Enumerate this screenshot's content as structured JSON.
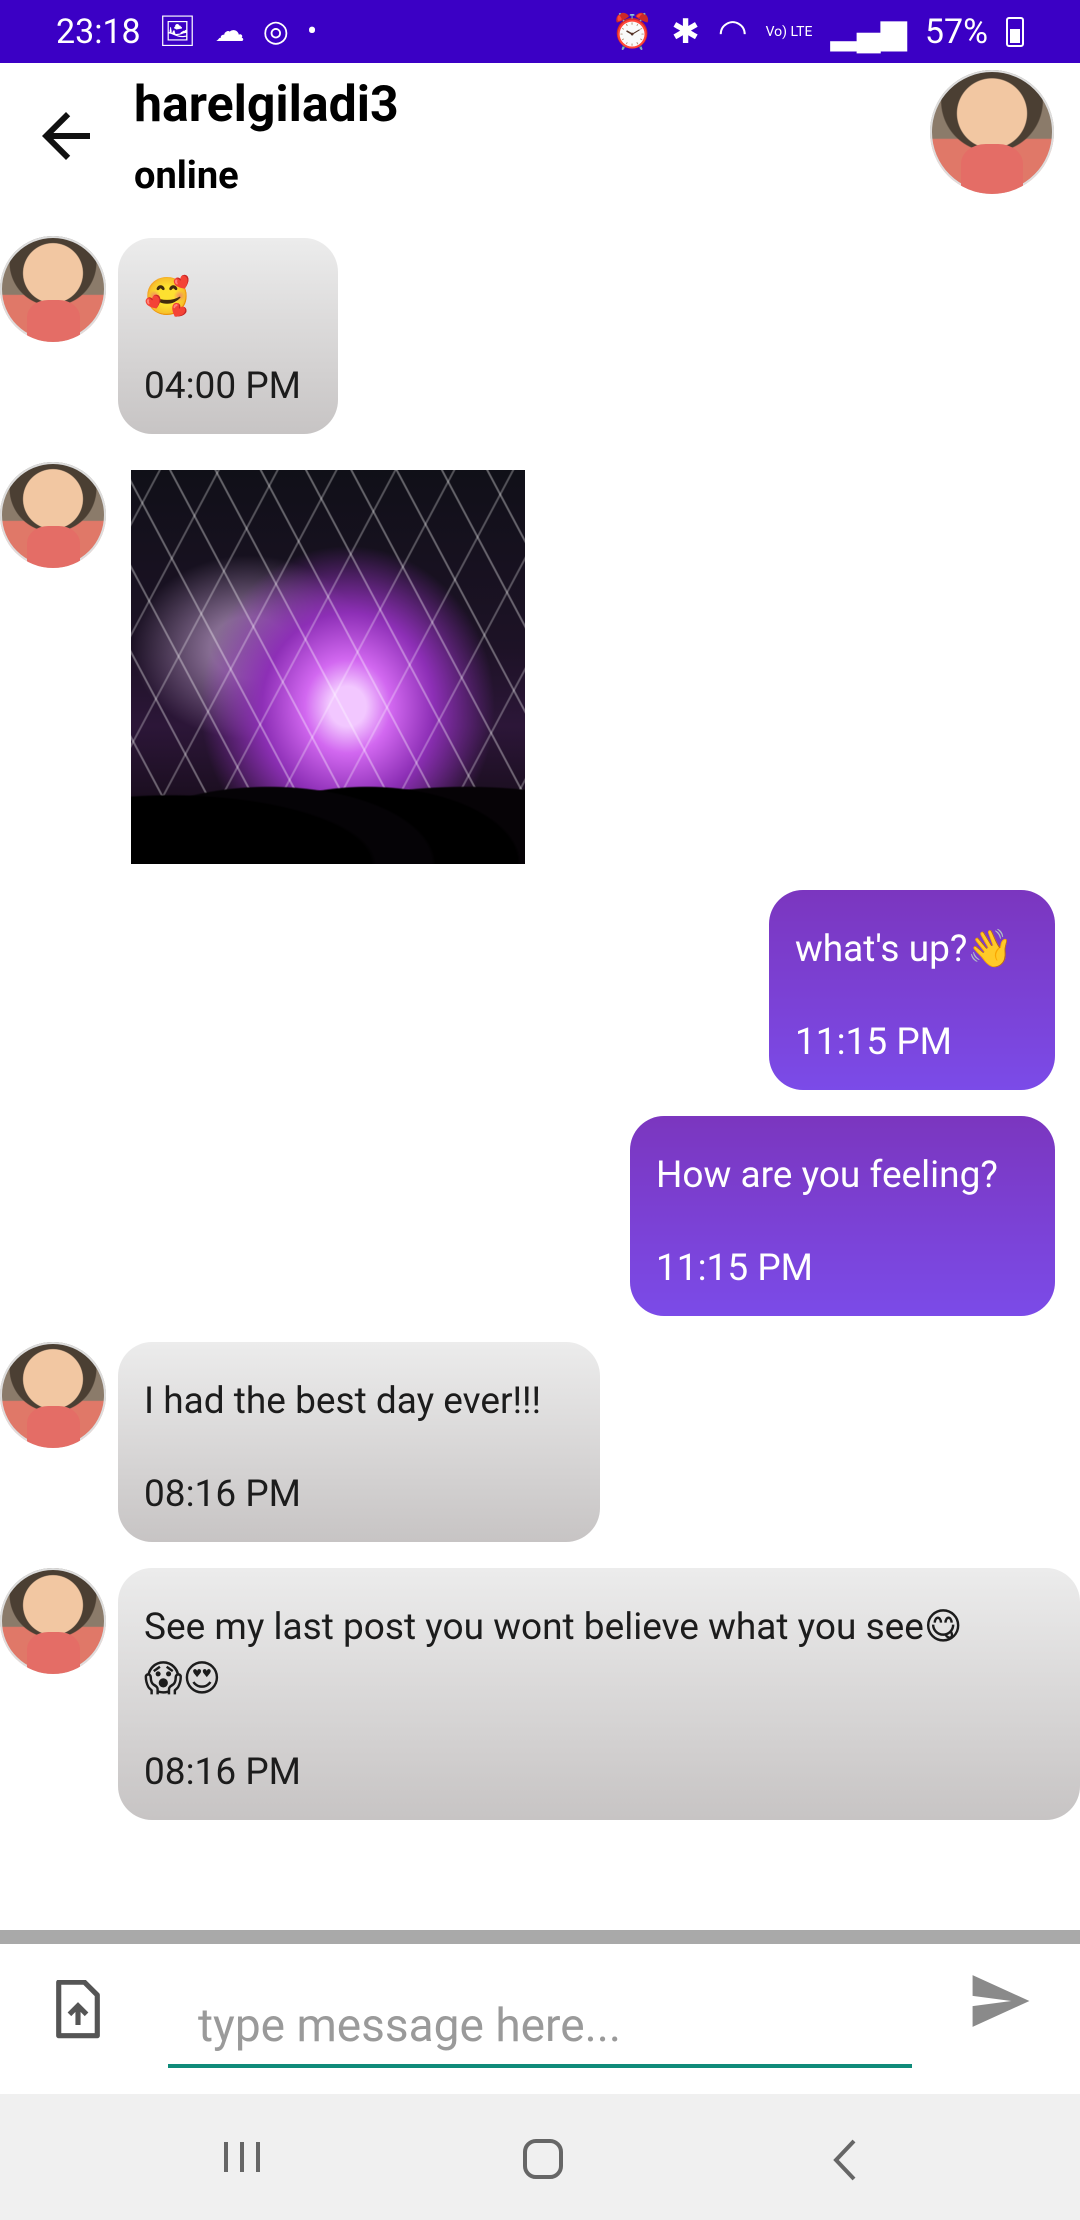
{
  "status_bar": {
    "time": "23:18",
    "battery": "57%",
    "network_label": "Vo) LTE",
    "left_icons": [
      "image-icon",
      "cloud-icon",
      "sync-icon",
      "dot-icon"
    ],
    "right_icons": [
      "alarm-icon",
      "bluetooth-icon",
      "wifi-icon",
      "signal-icon",
      "battery-icon"
    ],
    "background": "#3b00c5"
  },
  "header": {
    "contact_name": "harelgiladi3",
    "status": "online"
  },
  "messages": [
    {
      "direction": "in",
      "text": "🥰",
      "time": "04:00 PM"
    },
    {
      "direction": "in",
      "type": "image"
    },
    {
      "direction": "out",
      "text": "what's up?👋",
      "time": "11:15 PM"
    },
    {
      "direction": "out",
      "text": "How are you feeling?",
      "time": "11:15 PM"
    },
    {
      "direction": "in",
      "text": "I had the best day ever!!!",
      "time": "08:16 PM"
    },
    {
      "direction": "in",
      "text": "See my last post you wont believe what you see😋\n😱😍",
      "time": "08:16 PM"
    }
  ],
  "composer": {
    "placeholder": "type message here...",
    "value": ""
  },
  "colors": {
    "incoming_bubble": "#d8d6d6",
    "outgoing_bubble": "#7b3fd8",
    "input_underline": "#0f8b7a"
  }
}
